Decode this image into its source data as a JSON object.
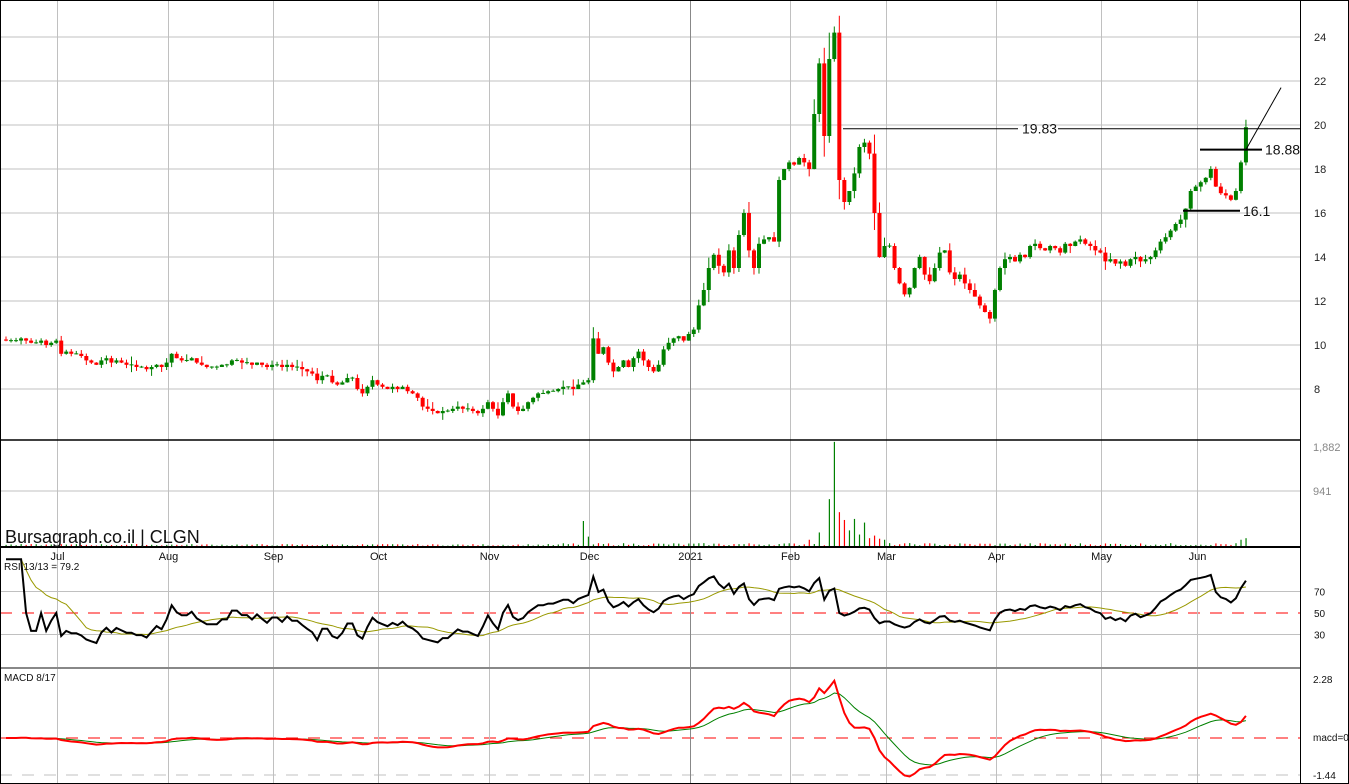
{
  "chart_data": {
    "type": "candlestick",
    "watermark": "Bursagraph.co.il | CLGN",
    "symbol": "CLGN",
    "months": [
      "Jul",
      "Aug",
      "Sep",
      "Oct",
      "Nov",
      "Dec",
      "2021",
      "Feb",
      "Mar",
      "Apr",
      "May",
      "Jun"
    ],
    "month_start_index": [
      11,
      33,
      54,
      75,
      97,
      117,
      137,
      157,
      176,
      198,
      219,
      238
    ],
    "price_axis": {
      "ticks": [
        "8",
        "10",
        "12",
        "14",
        "16",
        "18",
        "20",
        "22",
        "24"
      ],
      "ylim": [
        6,
        25
      ]
    },
    "closes": [
      10.2,
      10.2,
      10.2,
      10.3,
      10.2,
      10.1,
      10.1,
      10.2,
      10.0,
      10.1,
      10.2,
      9.6,
      9.7,
      9.6,
      9.6,
      9.5,
      9.3,
      9.2,
      9.1,
      9.3,
      9.4,
      9.2,
      9.3,
      9.2,
      9.1,
      9.1,
      9.0,
      9.0,
      8.9,
      9.0,
      9.1,
      9.0,
      9.2,
      9.6,
      9.4,
      9.3,
      9.3,
      9.4,
      9.2,
      9.1,
      9.0,
      9.0,
      9.0,
      9.1,
      9.1,
      9.3,
      9.3,
      9.2,
      9.2,
      9.1,
      9.2,
      9.1,
      9.0,
      9.1,
      9.1,
      9.0,
      9.1,
      9.0,
      9.0,
      8.9,
      8.8,
      8.7,
      8.4,
      8.6,
      8.6,
      8.3,
      8.2,
      8.3,
      8.5,
      8.5,
      8.0,
      7.8,
      8.1,
      8.4,
      8.2,
      8.1,
      8.0,
      8.1,
      8.0,
      8.1,
      7.9,
      7.8,
      7.6,
      7.2,
      7.1,
      7.0,
      6.9,
      7.0,
      7.0,
      7.1,
      7.2,
      7.1,
      7.1,
      7.0,
      6.9,
      7.1,
      7.4,
      7.1,
      6.8,
      7.4,
      7.8,
      7.2,
      7.0,
      7.1,
      7.4,
      7.6,
      7.8,
      7.8,
      7.9,
      7.9,
      8.0,
      8.1,
      8.1,
      8.0,
      8.2,
      8.3,
      8.4,
      10.3,
      9.6,
      9.9,
      9.2,
      8.8,
      9.0,
      9.3,
      9.0,
      9.4,
      9.7,
      9.3,
      9.0,
      8.8,
      9.1,
      9.8,
      10.1,
      10.3,
      10.4,
      10.2,
      10.5,
      10.7,
      11.8,
      12.5,
      13.5,
      14.1,
      13.6,
      13.3,
      14.3,
      13.5,
      15.0,
      16.0,
      14.3,
      13.5,
      14.6,
      14.8,
      14.9,
      14.7,
      17.5,
      18.0,
      18.3,
      18.2,
      18.5,
      18.3,
      18.0,
      20.5,
      22.8,
      19.5,
      23.0,
      24.2,
      17.5,
      16.5,
      17.0,
      17.8,
      19.0,
      19.2,
      18.7,
      16.0,
      14.0,
      14.5,
      14.5,
      13.5,
      12.8,
      12.3,
      12.6,
      13.5,
      14.0,
      13.2,
      12.9,
      13.5,
      14.2,
      14.3,
      13.3,
      13.0,
      13.2,
      12.8,
      12.5,
      12.2,
      11.8,
      11.5,
      11.2,
      12.5,
      13.5,
      13.9,
      14.0,
      13.8,
      14.1,
      14.0,
      14.5,
      14.6,
      14.4,
      14.3,
      14.5,
      14.4,
      14.2,
      14.6,
      14.5,
      14.7,
      14.8,
      14.6,
      14.5,
      14.3,
      14.2,
      13.8,
      13.9,
      13.7,
      13.8,
      13.6,
      13.9,
      14.0,
      13.8,
      13.9,
      14.0,
      14.3,
      14.7,
      14.9,
      15.2,
      15.5,
      15.7,
      16.2,
      17.0,
      17.2,
      17.4,
      17.6,
      18.0,
      17.2,
      16.9,
      16.8,
      16.6,
      17.0,
      18.3,
      19.9
    ],
    "levels": [
      {
        "label": "19.83",
        "value": 19.83
      },
      {
        "label": "18.88",
        "value": 18.88
      },
      {
        "label": "16.1",
        "value": 16.1
      }
    ],
    "trendline": {
      "from": [
        247,
        18.88
      ],
      "to": [
        253,
        21.7
      ]
    },
    "volume": {
      "ticks": [
        "1,882",
        "941"
      ],
      "max": 1882,
      "base": 25,
      "spikes": [
        [
          115,
          480
        ],
        [
          116,
          180
        ],
        [
          160,
          120
        ],
        [
          162,
          260
        ],
        [
          164,
          900
        ],
        [
          165,
          2000
        ],
        [
          166,
          650
        ],
        [
          167,
          500
        ],
        [
          168,
          300
        ],
        [
          169,
          520
        ],
        [
          170,
          220
        ],
        [
          171,
          450
        ],
        [
          172,
          150
        ],
        [
          173,
          200
        ],
        [
          174,
          140
        ],
        [
          175,
          120
        ],
        [
          246,
          120
        ],
        [
          247,
          150
        ]
      ]
    },
    "rsi": {
      "label": "RSI 13/13 = 79.2",
      "period": 13,
      "ma": 13,
      "ticks": [
        "70",
        "50",
        "30"
      ],
      "colors": {
        "rsi": "#000000",
        "ma": "#999900",
        "mid": "#ff0000"
      }
    },
    "macd": {
      "label": "MACD 8/17",
      "fast": 8,
      "slow": 17,
      "signal": 9,
      "ticks": [
        "2.28",
        "macd=0",
        "-1.44"
      ],
      "colors": {
        "macd": "#ff0000",
        "signal": "#008000"
      }
    },
    "colors": {
      "up": "#008000",
      "down": "#ff0000",
      "grid": "#c0c0c0"
    }
  }
}
